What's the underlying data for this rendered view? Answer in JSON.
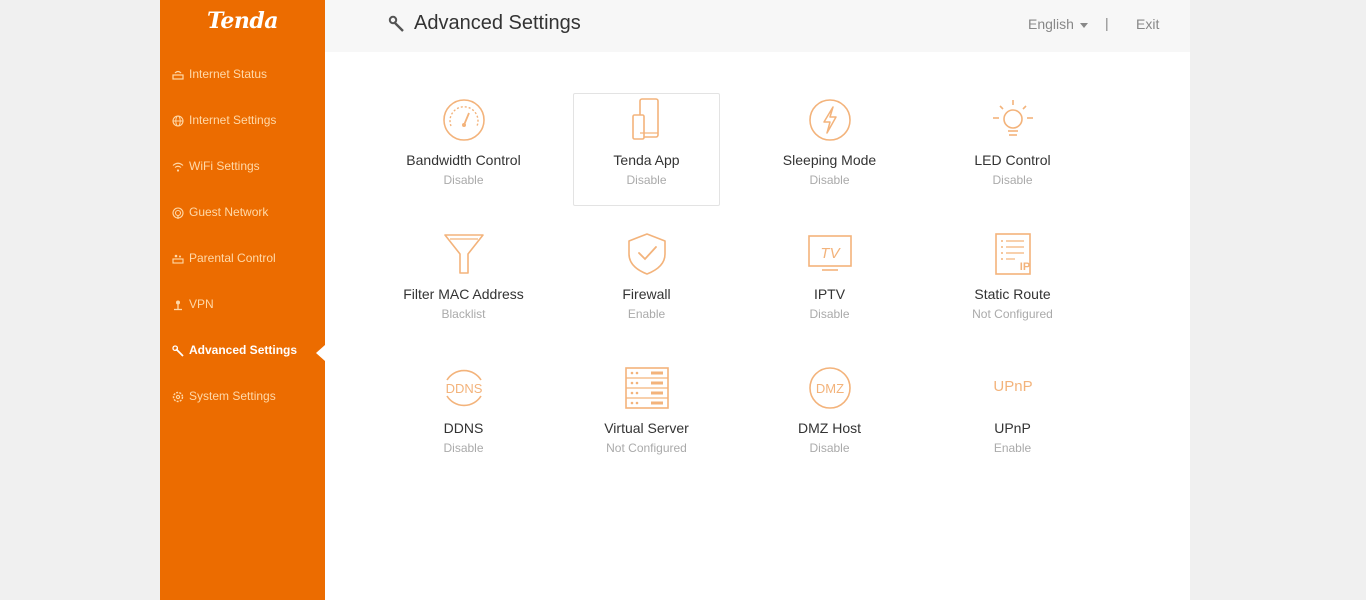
{
  "brand": {
    "logo_text": "Tenda",
    "accent": "#ec6c00"
  },
  "sidebar": {
    "items": [
      {
        "label": "Internet Status",
        "icon": "router-status-icon"
      },
      {
        "label": "Internet Settings",
        "icon": "globe-icon"
      },
      {
        "label": "WiFi Settings",
        "icon": "wifi-icon"
      },
      {
        "label": "Guest Network",
        "icon": "guest-wifi-icon"
      },
      {
        "label": "Parental Control",
        "icon": "parental-control-icon"
      },
      {
        "label": "VPN",
        "icon": "vpn-icon"
      },
      {
        "label": "Advanced Settings",
        "icon": "wrench-icon",
        "active": true
      },
      {
        "label": "System Settings",
        "icon": "gear-icon"
      }
    ]
  },
  "header": {
    "title": "Advanced Settings",
    "language": "English",
    "separator": "|",
    "exit_label": "Exit"
  },
  "tiles": [
    {
      "name": "Bandwidth Control",
      "status": "Disable",
      "icon": "speedometer-icon"
    },
    {
      "name": "Tenda App",
      "status": "Disable",
      "icon": "mobile-app-icon"
    },
    {
      "name": "Sleeping Mode",
      "status": "Disable",
      "icon": "sleep-bolt-icon"
    },
    {
      "name": "LED Control",
      "status": "Disable",
      "icon": "lightbulb-icon"
    },
    {
      "name": "Filter MAC Address",
      "status": "Blacklist",
      "icon": "filter-icon"
    },
    {
      "name": "Firewall",
      "status": "Enable",
      "icon": "shield-check-icon"
    },
    {
      "name": "IPTV",
      "status": "Disable",
      "icon": "tv-icon",
      "icon_text": "TV"
    },
    {
      "name": "Static Route",
      "status": "Not Configured",
      "icon": "route-list-icon",
      "icon_text": "IP"
    },
    {
      "name": "DDNS",
      "status": "Disable",
      "icon": "ddns-icon",
      "icon_text": "DDNS"
    },
    {
      "name": "Virtual Server",
      "status": "Not Configured",
      "icon": "server-icon"
    },
    {
      "name": "DMZ Host",
      "status": "Disable",
      "icon": "dmz-icon",
      "icon_text": "DMZ"
    },
    {
      "name": "UPnP",
      "status": "Enable",
      "icon": "upnp-icon",
      "icon_text": "UPnP"
    }
  ]
}
